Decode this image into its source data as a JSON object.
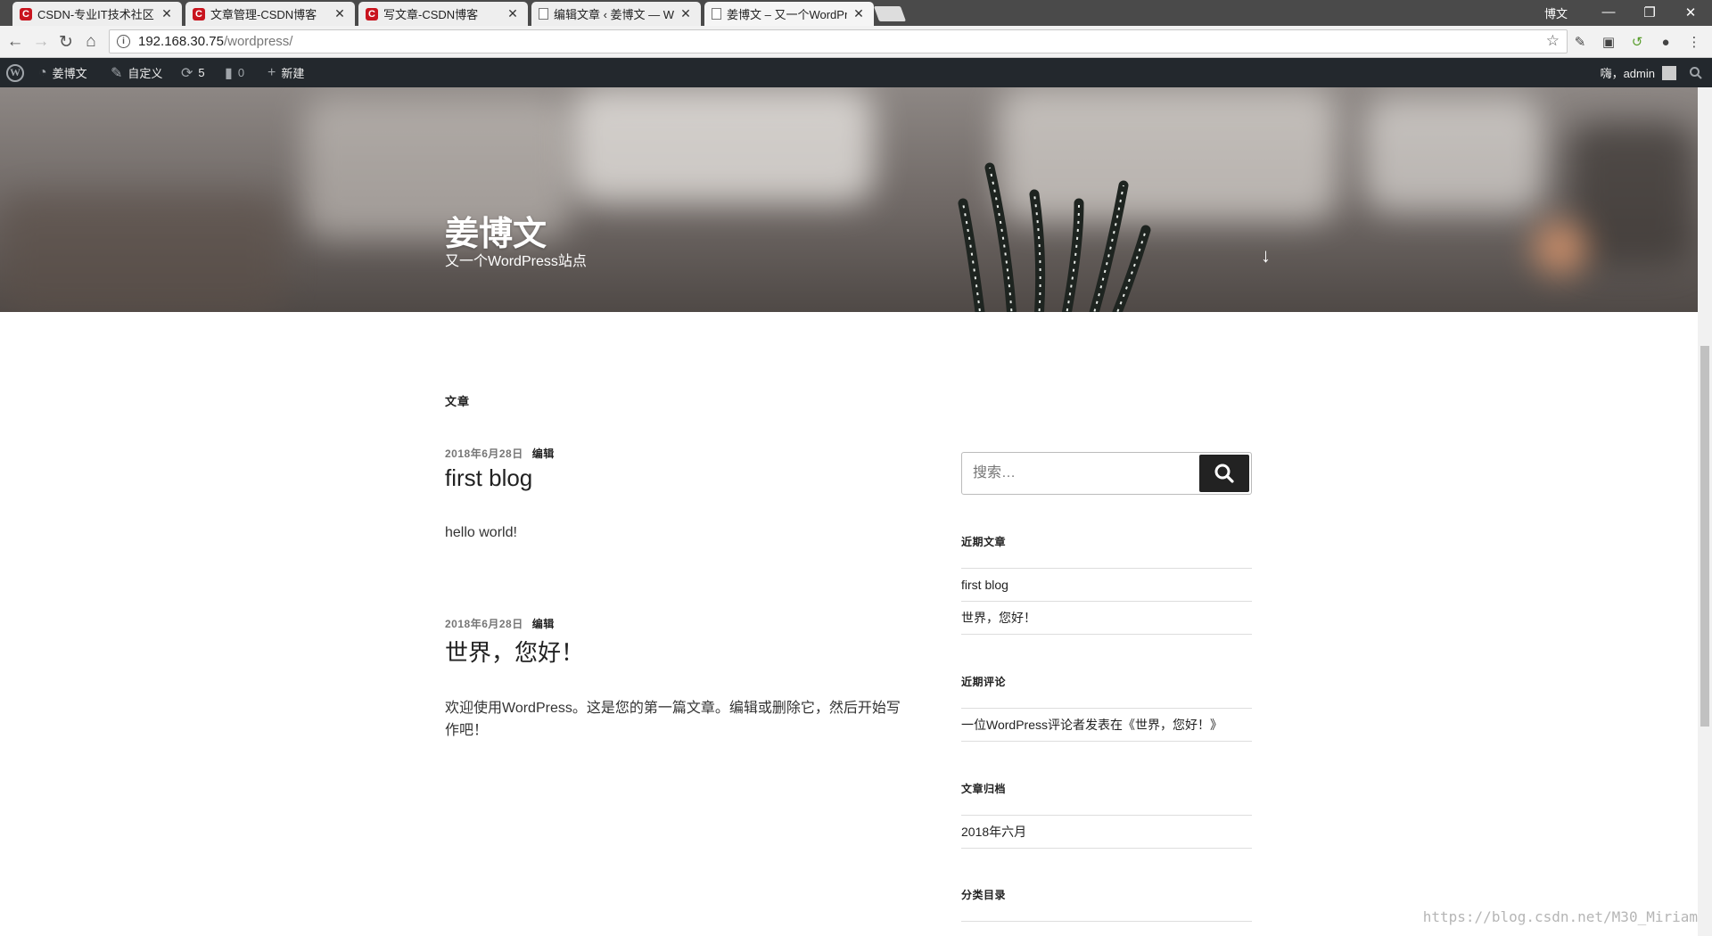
{
  "browser": {
    "tabs": [
      {
        "title": "CSDN-专业IT技术社区",
        "favicon": "csdn-icon"
      },
      {
        "title": "文章管理-CSDN博客",
        "favicon": "csdn-icon"
      },
      {
        "title": "写文章-CSDN博客",
        "favicon": "csdn-icon"
      },
      {
        "title": "编辑文章 ‹ 姜博文 — Wo",
        "favicon": "page-icon"
      },
      {
        "title": "姜博文 – 又一个WordPre",
        "favicon": "page-icon",
        "active": true
      }
    ],
    "window_user": "博文",
    "url_host": "192.168.30.75",
    "url_path": "/wordpress/"
  },
  "adminbar": {
    "site_name": "姜博文",
    "customize": "自定义",
    "updates_count": "5",
    "comments_count": "0",
    "new_label": "新建",
    "greeting": "嗨，admin"
  },
  "header": {
    "site_title": "姜博文",
    "site_description": "又一个WordPress站点"
  },
  "main": {
    "section_title": "文章",
    "posts": [
      {
        "date": "2018年6月28日",
        "edit": "编辑",
        "title": "first blog",
        "excerpt": "hello world!"
      },
      {
        "date": "2018年6月28日",
        "edit": "编辑",
        "title": "世界，您好！",
        "excerpt": "欢迎使用WordPress。这是您的第一篇文章。编辑或删除它，然后开始写作吧！"
      }
    ]
  },
  "sidebar": {
    "search_placeholder": "搜索…",
    "recent_posts_title": "近期文章",
    "recent_posts": [
      "first blog",
      "世界，您好！"
    ],
    "recent_comments_title": "近期评论",
    "recent_comments": [
      "一位WordPress评论者发表在《世界，您好！》"
    ],
    "archives_title": "文章归档",
    "archives": [
      "2018年六月"
    ],
    "categories_title": "分类目录"
  },
  "watermark": "https://blog.csdn.net/M30_Miriam"
}
